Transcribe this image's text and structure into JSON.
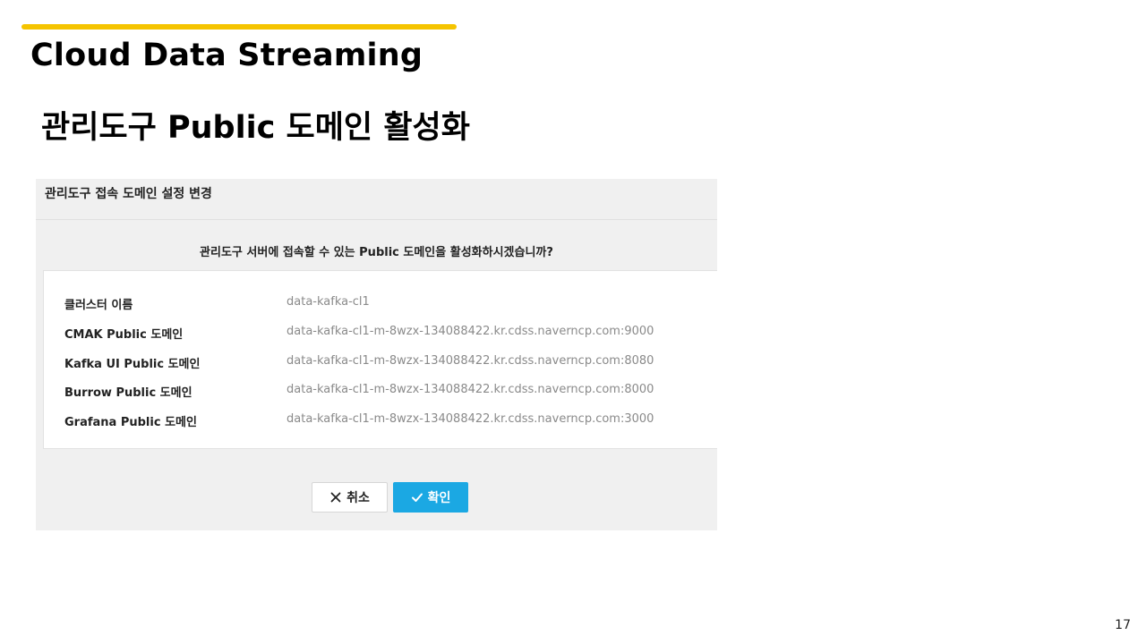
{
  "slide": {
    "title": "Cloud Data Streaming",
    "subtitle": "관리도구 Public 도메인 활성화",
    "page_number": "17",
    "accent_color": "#f5c400"
  },
  "dialog": {
    "title": "관리도구 접속 도메인 설정 변경",
    "question": "관리도구 서버에 접속할 수 있는 Public 도메인을 활성화하시겠습니까?",
    "rows": [
      {
        "label": "클러스터 이름",
        "value": "data-kafka-cl1"
      },
      {
        "label": "CMAK Public 도메인",
        "value": "data-kafka-cl1-m-8wzx-134088422.kr.cdss.naverncp.com:9000"
      },
      {
        "label": "Kafka UI Public 도메인",
        "value": "data-kafka-cl1-m-8wzx-134088422.kr.cdss.naverncp.com:8080"
      },
      {
        "label": "Burrow Public 도메인",
        "value": "data-kafka-cl1-m-8wzx-134088422.kr.cdss.naverncp.com:8000"
      },
      {
        "label": "Grafana Public 도메인",
        "value": "data-kafka-cl1-m-8wzx-134088422.kr.cdss.naverncp.com:3000"
      }
    ],
    "cancel_label": "취소",
    "cancel_icon": "close-icon",
    "confirm_label": "확인",
    "confirm_icon": "check-icon",
    "confirm_color": "#1ba8e3"
  }
}
